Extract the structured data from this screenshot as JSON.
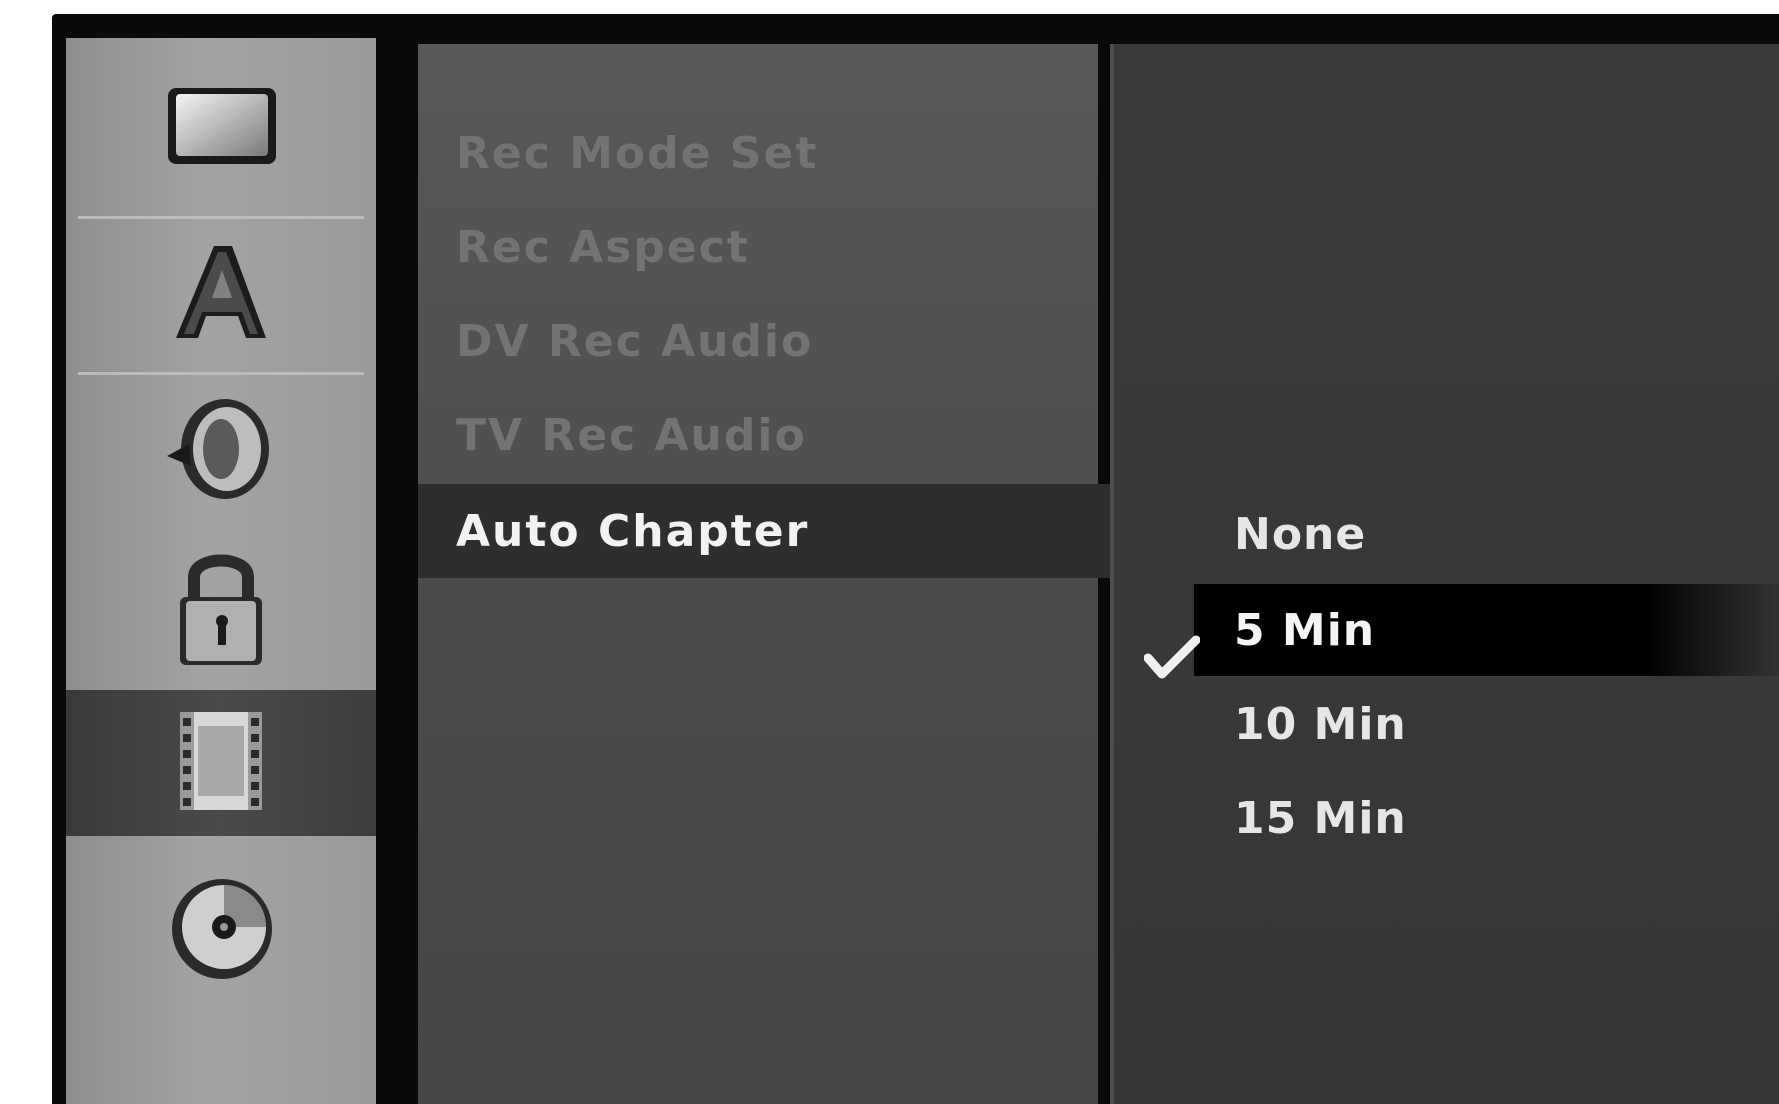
{
  "sidebar": {
    "icons": [
      {
        "name": "display-icon",
        "selected": false
      },
      {
        "name": "language-icon",
        "selected": false
      },
      {
        "name": "audio-icon",
        "selected": false
      },
      {
        "name": "lock-icon",
        "selected": false
      },
      {
        "name": "recording-icon",
        "selected": true
      },
      {
        "name": "disc-icon",
        "selected": false
      }
    ]
  },
  "menu": {
    "items": [
      {
        "label": "Rec Mode Set",
        "state": "disabled"
      },
      {
        "label": "Rec Aspect",
        "state": "disabled"
      },
      {
        "label": "DV Rec Audio",
        "state": "disabled"
      },
      {
        "label": "TV Rec Audio",
        "state": "disabled"
      },
      {
        "label": "Auto Chapter",
        "state": "active"
      }
    ]
  },
  "options": {
    "items": [
      {
        "label": "None",
        "selected": false
      },
      {
        "label": "5 Min",
        "selected": true
      },
      {
        "label": "10 Min",
        "selected": false
      },
      {
        "label": "15 Min",
        "selected": false
      }
    ],
    "selected_indicator": "checkmark-icon"
  }
}
